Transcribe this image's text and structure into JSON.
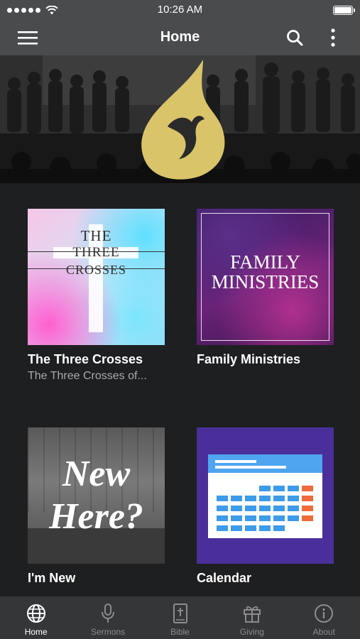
{
  "status": {
    "time": "10:26 AM"
  },
  "nav": {
    "title": "Home"
  },
  "tiles": [
    {
      "title": "The Three Crosses",
      "subtitle": "The Three Crosses of...",
      "art_text": [
        "THE",
        "THREE",
        "CROSSES"
      ]
    },
    {
      "title": "Family Ministries",
      "subtitle": "",
      "art_text": [
        "FAMILY",
        "MINISTRIES"
      ]
    },
    {
      "title": "I'm New",
      "subtitle": "",
      "art_text": [
        "New",
        "Here?"
      ]
    },
    {
      "title": "Calendar",
      "subtitle": ""
    }
  ],
  "tabs": [
    {
      "label": "Home",
      "icon": "globe-icon",
      "active": true
    },
    {
      "label": "Sermons",
      "icon": "microphone-icon",
      "active": false
    },
    {
      "label": "Bible",
      "icon": "bible-icon",
      "active": false
    },
    {
      "label": "Giving",
      "icon": "gift-icon",
      "active": false
    },
    {
      "label": "About",
      "icon": "info-icon",
      "active": false
    }
  ],
  "colors": {
    "bar_bg": "#4a4b4d",
    "content_bg": "#1e1f21",
    "tab_bar_bg": "#353638",
    "flame_gold": "#d9c46a",
    "calendar_bg": "#4a2f9a",
    "calendar_header": "#4fa5f0",
    "calendar_cell": "#3d9be9",
    "calendar_accent": "#f06a3a"
  }
}
